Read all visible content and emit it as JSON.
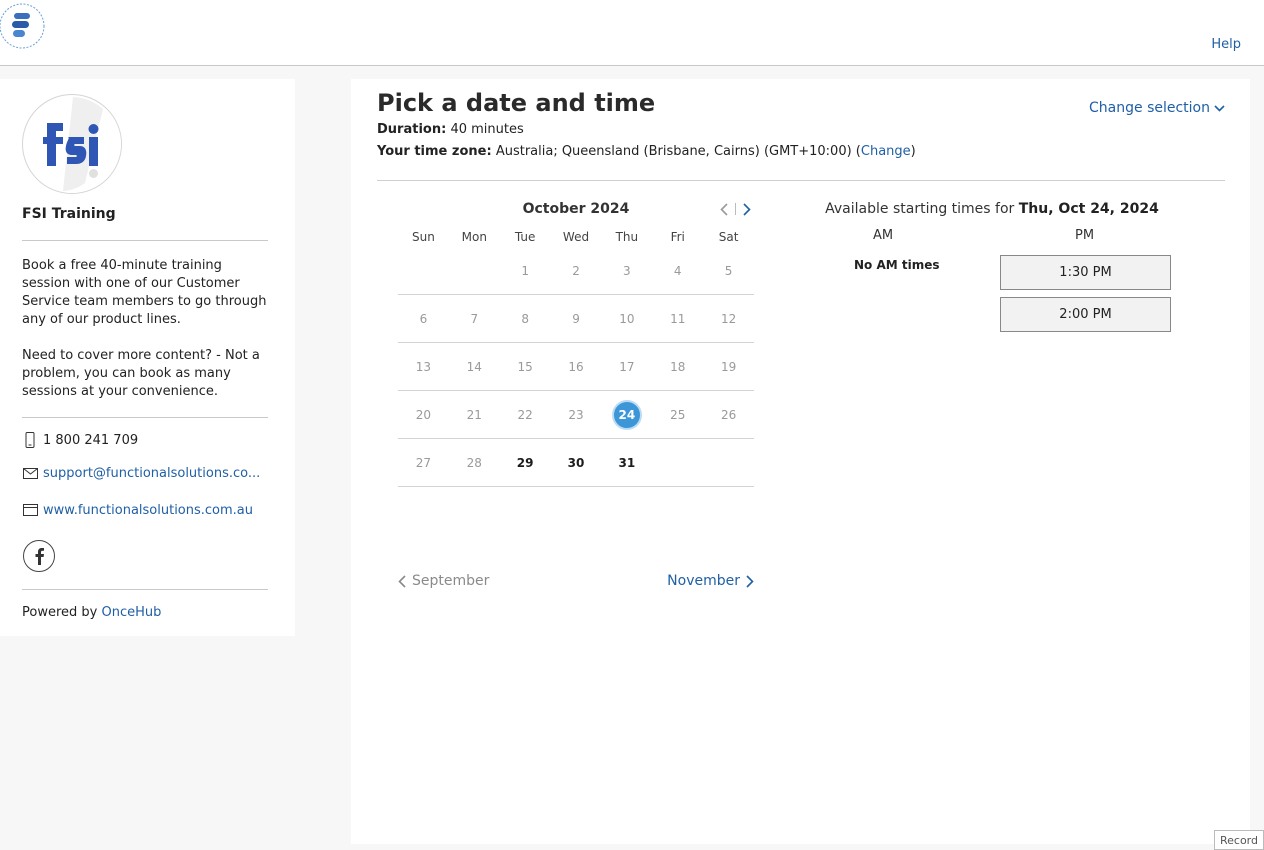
{
  "header": {
    "logo_icon": "functional-solutions-logo-icon",
    "help_label": "Help"
  },
  "sidebar": {
    "avatar_icon": "fsi-logo-icon",
    "title": "FSI Training",
    "description": [
      "Book a free 40-minute training session with one of our Customer Service team members to go through any of our product lines.",
      "Need to cover more content? - Not a problem, you can book as many sessions at your convenience."
    ],
    "phone": "1 800 241 709",
    "email": "support@functionalsolutions.co...",
    "website": "www.functionalsolutions.com.au",
    "powered_prefix": "Powered by",
    "powered_link": "OnceHub"
  },
  "main": {
    "title": "Pick a date and time",
    "duration_label": "Duration:",
    "duration_value": "40 minutes",
    "timezone_label": "Your time zone:",
    "timezone_value": "Australia; Queensland (Brisbane, Cairns) (GMT+10:00)",
    "timezone_change": "Change",
    "change_selection": "Change selection"
  },
  "calendar": {
    "month_label": "October 2024",
    "weekdays": [
      "Sun",
      "Mon",
      "Tue",
      "Wed",
      "Thu",
      "Fri",
      "Sat"
    ],
    "weeks": [
      [
        {
          "d": ""
        },
        {
          "d": ""
        },
        {
          "d": "1"
        },
        {
          "d": "2"
        },
        {
          "d": "3"
        },
        {
          "d": "4"
        },
        {
          "d": "5"
        }
      ],
      [
        {
          "d": "6"
        },
        {
          "d": "7"
        },
        {
          "d": "8"
        },
        {
          "d": "9"
        },
        {
          "d": "10"
        },
        {
          "d": "11"
        },
        {
          "d": "12"
        }
      ],
      [
        {
          "d": "13"
        },
        {
          "d": "14"
        },
        {
          "d": "15"
        },
        {
          "d": "16"
        },
        {
          "d": "17"
        },
        {
          "d": "18"
        },
        {
          "d": "19"
        }
      ],
      [
        {
          "d": "20"
        },
        {
          "d": "21"
        },
        {
          "d": "22"
        },
        {
          "d": "23"
        },
        {
          "d": "24",
          "s": "selected"
        },
        {
          "d": "25"
        },
        {
          "d": "26"
        }
      ],
      [
        {
          "d": "27"
        },
        {
          "d": "28"
        },
        {
          "d": "29",
          "s": "available"
        },
        {
          "d": "30",
          "s": "available"
        },
        {
          "d": "31",
          "s": "available"
        },
        {
          "d": ""
        },
        {
          "d": ""
        }
      ]
    ],
    "prev_month": "September",
    "next_month": "November",
    "selected_color": "#3d96d8"
  },
  "times": {
    "heading_prefix": "Available starting times for",
    "heading_date": "Thu, Oct 24, 2024",
    "am_label": "AM",
    "pm_label": "PM",
    "no_am": "No AM times",
    "pm_slots": [
      "1:30 PM",
      "2:00 PM"
    ]
  },
  "footer": {
    "record_label": "Record"
  }
}
